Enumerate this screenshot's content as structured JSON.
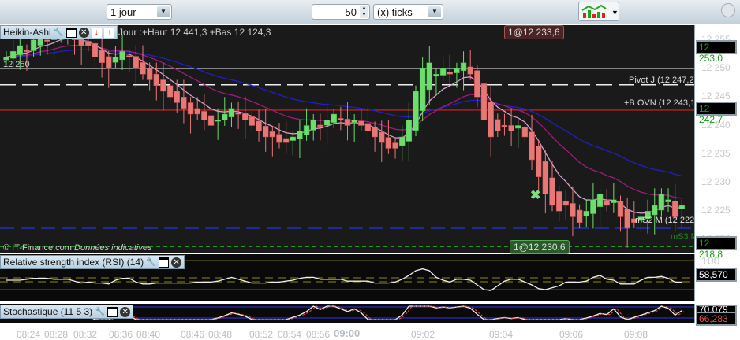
{
  "toolbar": {
    "period": "1 jour",
    "count": "50",
    "unit": "(x) ticks"
  },
  "main": {
    "title": "Heikin-Ashi",
    "info": "Jour :+Haut 12 441,3 +Bas 12 124,3",
    "left_price": "12 250",
    "copyright": "© IT-Finance.com",
    "disclaimer": "Données indicatives",
    "order_top": "1@12 233,6",
    "order_bottom": "1@12 230,6",
    "pivot": "Pivot J (12 247,2)",
    "ovn": "+B OVN (12 243,1)",
    "ms2": "mS2 M (12 222)",
    "ms3": "mS3 M",
    "price_current": "12 253,0",
    "price_ovn": "12 242,7",
    "price_low": "12 218,8",
    "y_ticks": [
      "12 255",
      "12 250",
      "12 245",
      "12 240",
      "12 235",
      "12 230",
      "12 225",
      "12 220"
    ],
    "colors": {
      "up": "#6fdc6f",
      "down": "#e87878",
      "bg": "#1a1a1a"
    },
    "closes": [
      12252,
      12253,
      12254,
      12253,
      12255,
      12256,
      12255,
      12256,
      12257,
      12256,
      12255,
      12254,
      12254,
      12252,
      12251,
      12250,
      12252,
      12253,
      12252,
      12250,
      12249,
      12248,
      12247,
      12246,
      12245,
      12244,
      12243,
      12242,
      12242,
      12241,
      12240,
      12241,
      12242,
      12243,
      12242,
      12241,
      12240,
      12239,
      12238,
      12238,
      12237,
      12237,
      12238,
      12239,
      12240,
      12241,
      12240,
      12241,
      12242,
      12241,
      12240,
      12241,
      12240,
      12239,
      12238,
      12237,
      12236,
      12236,
      12238,
      12241,
      12246,
      12250,
      12251,
      12249,
      12250,
      12249,
      12250,
      12251,
      12249,
      12245,
      12241,
      12238,
      12239,
      12240,
      12239,
      12240,
      12238,
      12234,
      12231,
      12228,
      12226,
      12225,
      12226,
      12224,
      12223,
      12225,
      12227,
      12228,
      12226,
      12227,
      12224,
      12222,
      12223,
      12224,
      12225,
      12226,
      12228,
      12227,
      12224,
      12226
    ]
  },
  "rsi": {
    "title": "Relative strength index (RSI) (14)",
    "tick": "100",
    "value": "58,570"
  },
  "stoch": {
    "title": "Stochastique (11 5 3)",
    "value1": "70,079",
    "value2": "66,283"
  },
  "x_ticks": [
    "08:24",
    "08:28",
    "08:32",
    "08:36",
    "08:40",
    "08:46",
    "08:48",
    "08:52",
    "08:54",
    "08:56",
    "09:00",
    "09:02",
    "09:04",
    "09:06",
    "09:08"
  ]
}
